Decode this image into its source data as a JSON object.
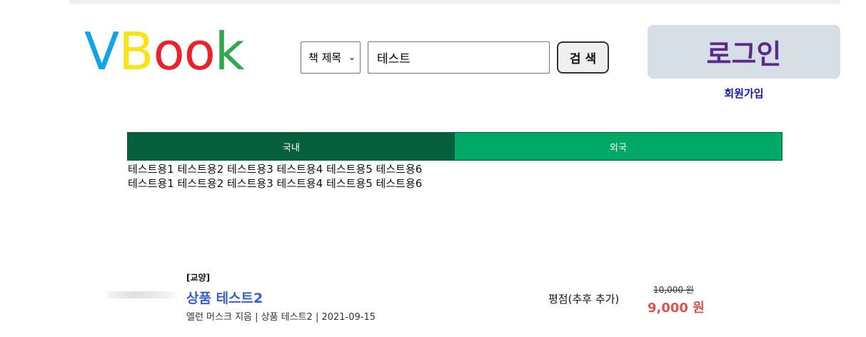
{
  "logo": {
    "letters": [
      "V",
      "B",
      "o",
      "o",
      "k"
    ]
  },
  "search": {
    "type_selected": "책 제목",
    "query_value": "테스트",
    "button_label": "검 색"
  },
  "auth": {
    "login_label": "로그인",
    "signup_label": "회원가입"
  },
  "tabs": [
    {
      "label": "국내"
    },
    {
      "label": "외국"
    }
  ],
  "category_lines": [
    "테스트용1 테스트용2 테스트용3 테스트용4 테스트용5 테스트용6",
    "테스트용1 테스트용2 테스트용3 테스트용4 테스트용5 테스트용6"
  ],
  "products": [
    {
      "category": "[교양]",
      "title": "상품 테스트2",
      "meta": "엘런 머스크 지음 | 상품 테스트2 | 2021-09-15",
      "rating": "평점(추후 추가)",
      "original_price": "10,000 원",
      "price": "9,000 원"
    }
  ],
  "colors": {
    "logo_v": "#12a5e6",
    "logo_b": "#f7e51a",
    "logo_o": "#e8232c",
    "logo_k": "#2fa84f",
    "tab_domestic": "#065f3d",
    "tab_foreign": "#02a865",
    "login_bg": "#d6dee6",
    "login_text": "#5b2a8c",
    "title_link": "#3a5fc8",
    "price": "#d9534f"
  },
  "icons": {
    "select_arrow": "chevron-down-icon"
  }
}
